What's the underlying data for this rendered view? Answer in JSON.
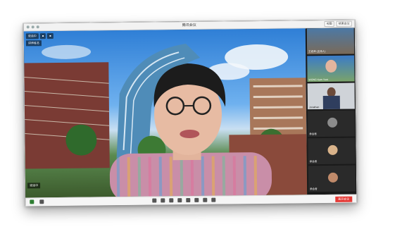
{
  "window": {
    "title": "腾讯会议",
    "buttons": [
      "视图",
      "结束会议"
    ]
  },
  "main": {
    "top_chips": [
      "说话中",
      "■",
      "■"
    ],
    "speaker_chip": "讲师姓名",
    "bottom_chip": "说话中"
  },
  "sidebar": {
    "tiles": [
      {
        "label": "王老师 (主持人)"
      },
      {
        "label": "WONG Kam Yuet"
      },
      {
        "label": "Jonathan"
      },
      {
        "label": "参会者"
      },
      {
        "label": "参会者"
      },
      {
        "label": "参会者"
      }
    ]
  },
  "toolbar": {
    "leave_label": "离开会议"
  },
  "colors": {
    "sky": "#2f7fd6",
    "leave": "#e53935"
  }
}
